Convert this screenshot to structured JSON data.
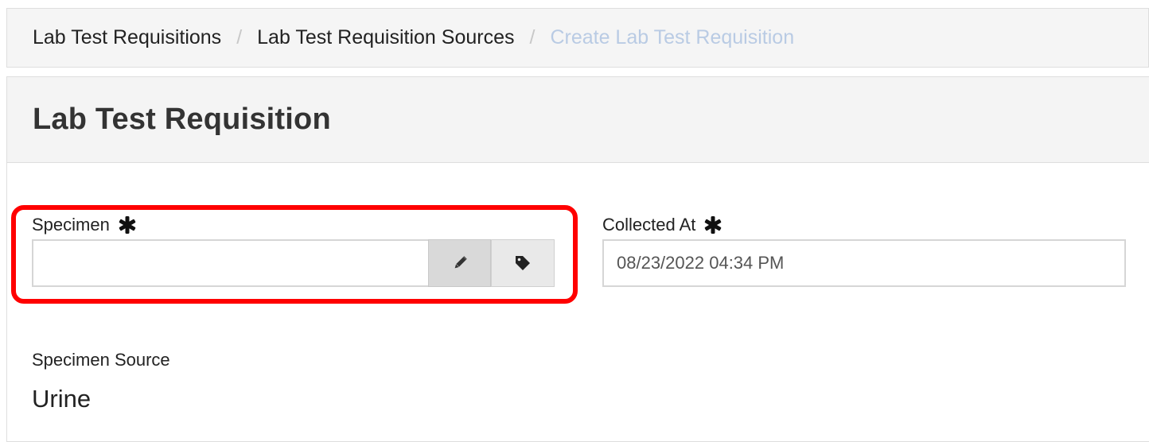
{
  "breadcrumb": {
    "items": [
      "Lab Test Requisitions",
      "Lab Test Requisition Sources"
    ],
    "current": "Create Lab Test Requisition",
    "separator": "/"
  },
  "panel": {
    "title": "Lab Test Requisition"
  },
  "form": {
    "specimen": {
      "label": "Specimen",
      "value": "",
      "required": true,
      "edit_icon": "pencil-icon",
      "tag_icon": "tag-icon"
    },
    "collected_at": {
      "label": "Collected At",
      "value": "08/23/2022 04:34 PM",
      "required": true
    },
    "specimen_source": {
      "label": "Specimen Source",
      "value": "Urine"
    }
  },
  "colors": {
    "highlight": "#ff0000",
    "breadcrumb_active": "#b9cbe4",
    "panel_header_bg": "#f4f4f4"
  }
}
